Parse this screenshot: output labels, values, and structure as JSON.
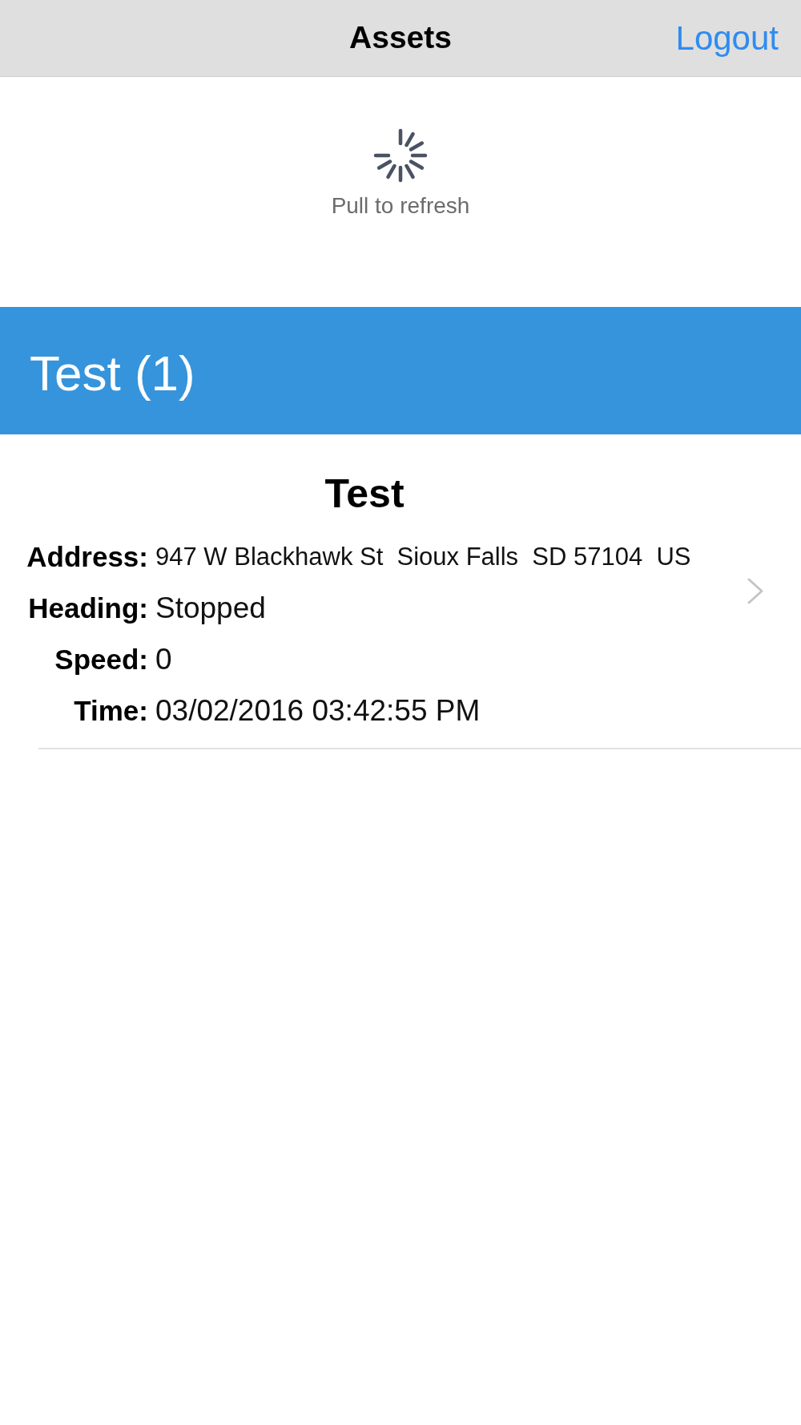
{
  "nav_bar": {
    "title": "Assets",
    "logout": "Logout"
  },
  "refresh": {
    "label": "Pull to refresh"
  },
  "groups": [
    {
      "title": "Test (1)",
      "assets": [
        {
          "name": "Test",
          "address": {
            "label": "Address:",
            "value": "947 W Blackhawk St  Sioux Falls  SD 57104  US"
          },
          "heading": {
            "label": "Heading:",
            "value": "Stopped"
          },
          "speed": {
            "label": "Speed:",
            "value": "0"
          },
          "time": {
            "label": "Time:",
            "value": "03/02/2016 03:42:55 PM"
          }
        }
      ]
    }
  ]
}
